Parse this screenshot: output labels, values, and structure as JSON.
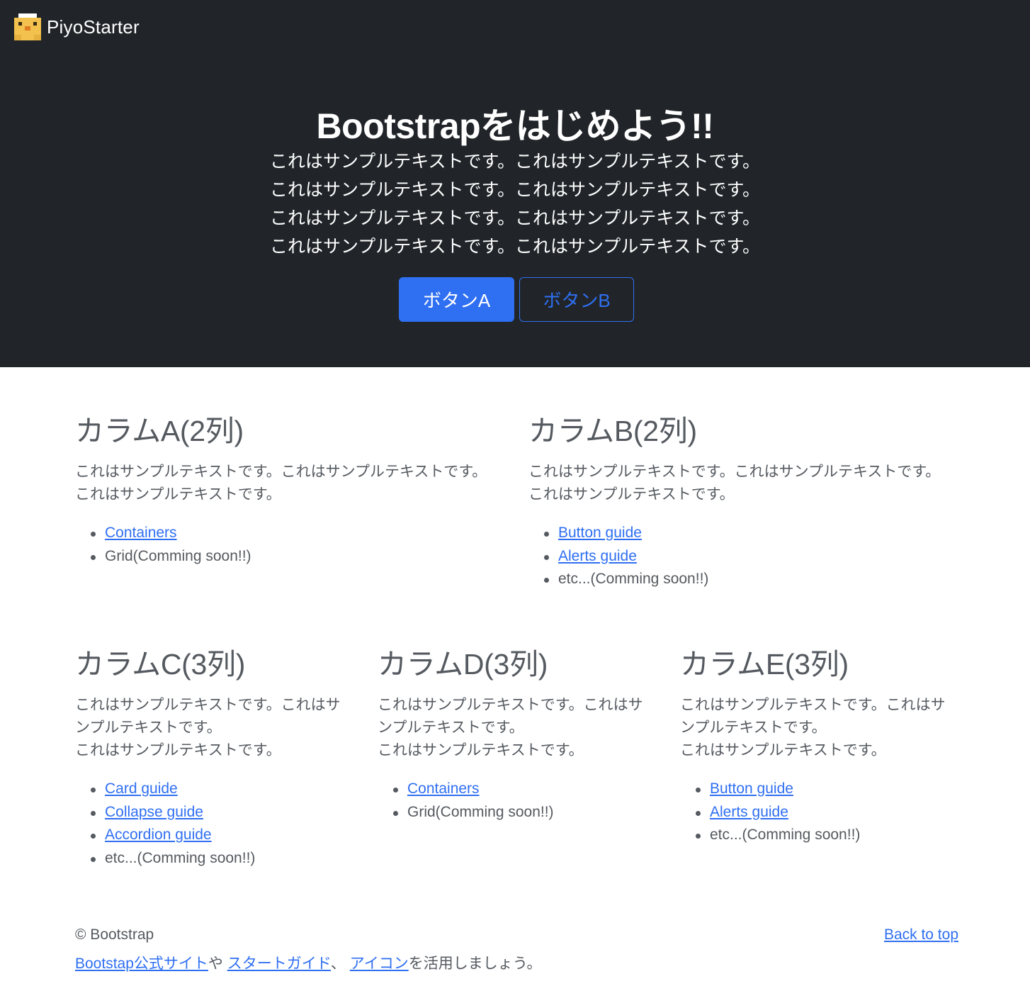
{
  "brand": {
    "name": "PiyoStarter",
    "logo_icon": "chick-pixel-icon",
    "logo_color": "#f2c14e"
  },
  "hero": {
    "title": "Bootstrapをはじめよう!!",
    "lines": [
      "これはサンプルテキストです。これはサンプルテキストです。",
      "これはサンプルテキストです。これはサンプルテキストです。",
      "これはサンプルテキストです。これはサンプルテキストです。",
      "これはサンプルテキストです。これはサンプルテキストです。"
    ],
    "button_a": "ボタンA",
    "button_b": "ボタンB",
    "background": "#212529",
    "accent": "#2f6ff2"
  },
  "columns": [
    {
      "title": "カラムA(2列)",
      "text": [
        "これはサンプルテキストです。これはサンプルテキストです。",
        "これはサンプルテキストです。"
      ],
      "items": [
        {
          "label": "Containers",
          "link": true
        },
        {
          "label": "Grid(Comming soon!!)",
          "link": false
        }
      ]
    },
    {
      "title": "カラムB(2列)",
      "text": [
        "これはサンプルテキストです。これはサンプルテキストです。",
        "これはサンプルテキストです。"
      ],
      "items": [
        {
          "label": "Button guide",
          "link": true
        },
        {
          "label": "Alerts guide",
          "link": true
        },
        {
          "label": "etc...(Comming soon!!)",
          "link": false
        }
      ]
    },
    {
      "title": "カラムC(3列)",
      "text": [
        "これはサンプルテキストです。これはサ",
        "ンプルテキストです。",
        "これはサンプルテキストです。"
      ],
      "items": [
        {
          "label": "Card guide",
          "link": true
        },
        {
          "label": "Collapse guide",
          "link": true
        },
        {
          "label": "Accordion guide",
          "link": true
        },
        {
          "label": "etc...(Comming soon!!)",
          "link": false
        }
      ]
    },
    {
      "title": "カラムD(3列)",
      "text": [
        "これはサンプルテキストです。これはサ",
        "ンプルテキストです。",
        "これはサンプルテキストです。"
      ],
      "items": [
        {
          "label": "Containers",
          "link": true
        },
        {
          "label": "Grid(Comming soon!!)",
          "link": false
        }
      ]
    },
    {
      "title": "カラムE(3列)",
      "text": [
        "これはサンプルテキストです。これはサ",
        "ンプルテキストです。",
        "これはサンプルテキストです。"
      ],
      "items": [
        {
          "label": "Button guide",
          "link": true
        },
        {
          "label": "Alerts guide",
          "link": true
        },
        {
          "label": "etc...(Comming soon!!)",
          "link": false
        }
      ]
    }
  ],
  "footer": {
    "copyright": "© Bootstrap",
    "link_official": "Bootstap公式サイト",
    "text_ya": "や ",
    "link_start": "スタートガイド",
    "text_comma": "、 ",
    "link_icon": "アイコン",
    "text_end": "を活用しましょう。",
    "back_to_top": "Back to top"
  }
}
